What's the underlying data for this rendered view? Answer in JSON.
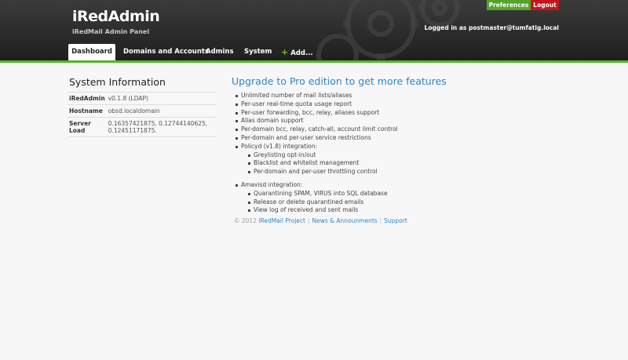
{
  "header": {
    "title": "iRedAdmin",
    "subtitle": "iRedMail Admin Panel",
    "preferences_label": "Preferences",
    "logout_label": "Logout",
    "login_text": "Logged in as postmaster@tumfatig.local"
  },
  "nav": {
    "dashboard": "Dashboard",
    "domains": "Domains and Accounts",
    "admins": "Admins",
    "system": "System",
    "add_plus": "+",
    "add": "Add..."
  },
  "sysinfo": {
    "title": "System Information",
    "rows": [
      {
        "key": "iRedAdmin",
        "value": "v0.1.8 (LDAP)"
      },
      {
        "key": "Hostname",
        "value": "obsd.localdomain"
      },
      {
        "key": "Server Load",
        "value": "0.16357421875, 0.12744140625, 0.12451171875."
      }
    ]
  },
  "upgrade": {
    "title": "Upgrade to Pro edition to get more features",
    "features": [
      "Unlimited number of mail lists/aliases",
      "Per-user real-time quota usage report",
      "Per-user forwarding, bcc, relay, aliases support",
      "Alias domain support",
      "Per-domain bcc, relay, catch-all, account limit control",
      "Per-domain and per-user service restrictions",
      "Policyd (v1.8) integration:"
    ],
    "policyd_sub": [
      "Greylisting opt-in/out",
      "Blacklist and whitelist management",
      "Per-domain and per-user throttling control"
    ],
    "amavisd": "Amavisd integration:",
    "amavisd_sub": [
      "Quarantining SPAM, VIRUS into SQL database",
      "Release or delete quarantined emails",
      "View log of received and sent mails"
    ]
  },
  "footer": {
    "copyright": "© 2012",
    "project": "iRedMail Project",
    "sep": "|",
    "news": "News & Announments",
    "support": "Support"
  },
  "colors": {
    "accent_green": "#59b025",
    "link_blue": "#2f86c9",
    "logout_red": "#c4151c"
  }
}
